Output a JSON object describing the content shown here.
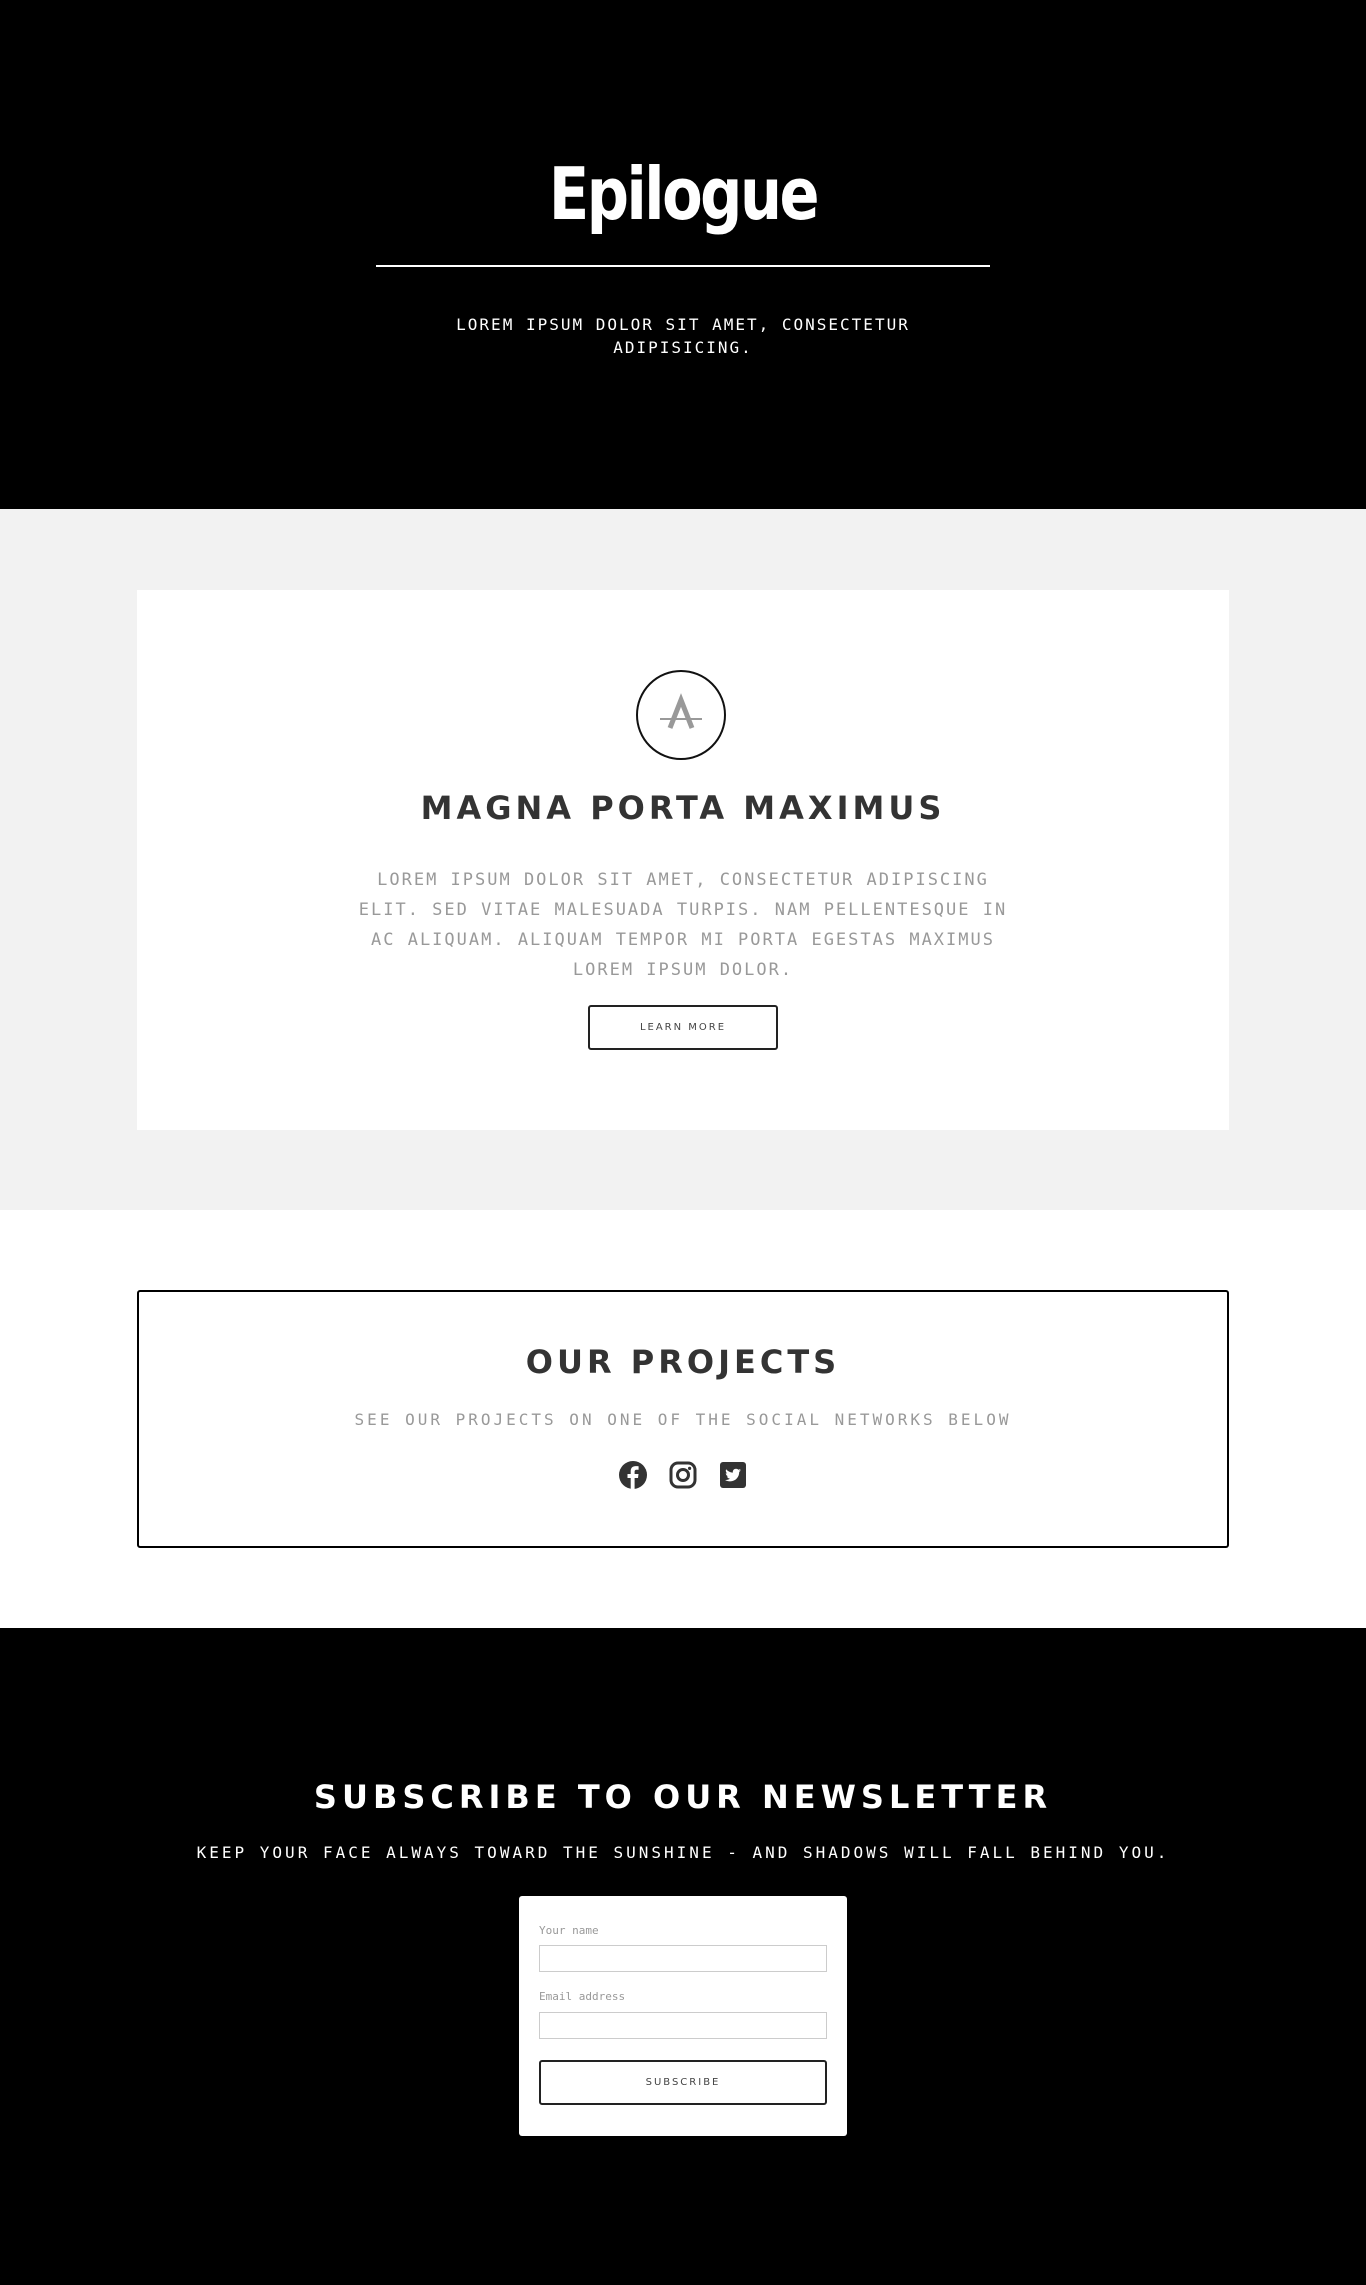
{
  "hero": {
    "title": "Epilogue",
    "subtitle": "LOREM IPSUM DOLOR SIT AMET, CONSECTETUR ADIPISICING."
  },
  "feature": {
    "logo_icon": "letter-a-logo-icon",
    "title": "MAGNA PORTA MAXIMUS",
    "text": "LOREM IPSUM DOLOR SIT AMET, CONSECTETUR ADIPISCING ELIT. SED VITAE MALESUADA TURPIS. NAM PELLENTESQUE IN AC ALIQUAM. ALIQUAM TEMPOR MI PORTA EGESTAS MAXIMUS LOREM IPSUM DOLOR.",
    "button_label": "LEARN MORE"
  },
  "projects": {
    "title": "OUR PROJECTS",
    "subtitle": "SEE OUR PROJECTS ON ONE OF THE SOCIAL NETWORKS BELOW",
    "social_icons": [
      "facebook-icon",
      "instagram-icon",
      "twitter-icon"
    ]
  },
  "newsletter": {
    "title": "SUBSCRIBE TO OUR NEWSLETTER",
    "subtitle": "KEEP YOUR FACE ALWAYS TOWARD THE SUNSHINE - AND SHADOWS WILL FALL BEHIND YOU.",
    "name_label": "Your name",
    "name_value": "",
    "email_label": "Email address",
    "email_value": "",
    "button_label": "SUBSCRIBE"
  },
  "colors": {
    "background_dark": "#000000",
    "band_light": "#f2f2f2",
    "heading_gray": "#333333",
    "text_gray": "#999999"
  }
}
